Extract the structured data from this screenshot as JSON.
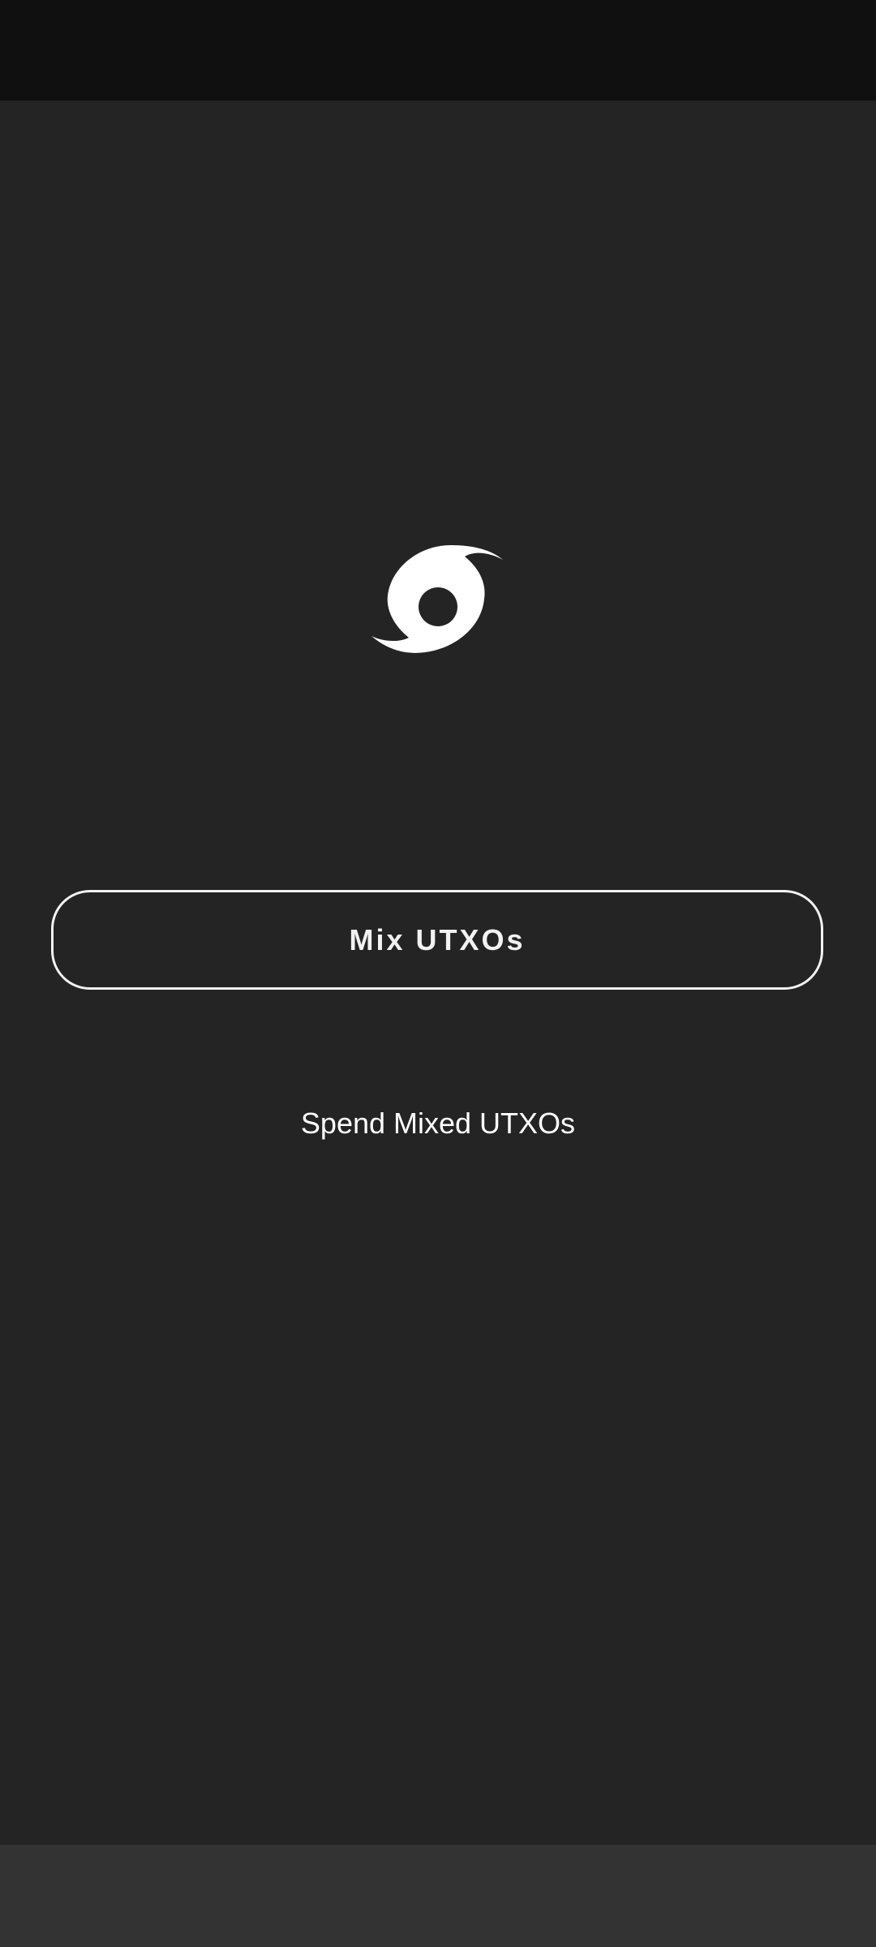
{
  "colors": {
    "status_bar": "#101010",
    "background": "#242424",
    "nav_bar": "#333333",
    "foreground": "#f2f2f2"
  },
  "logo": {
    "icon": "hurricane-icon"
  },
  "actions": {
    "mix_label": "Mix UTXOs",
    "spend_label": "Spend Mixed UTXOs"
  }
}
